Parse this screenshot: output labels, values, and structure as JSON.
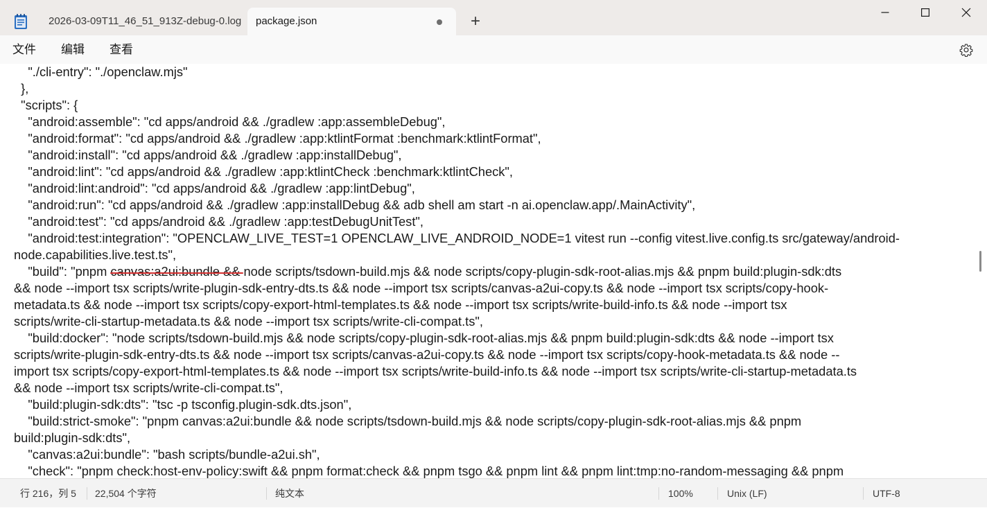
{
  "window": {
    "app_icon": "notepad-icon",
    "tabs": [
      {
        "label": "2026-03-09T11_46_51_913Z-debug-0.log",
        "active": false
      },
      {
        "label": "package.json",
        "active": true,
        "modified_indicator": "unsaved-dot-icon"
      }
    ],
    "new_tab_label": "+",
    "controls": [
      "minimize-icon",
      "maximize-icon",
      "close-icon"
    ]
  },
  "menu": {
    "items": [
      "文件",
      "编辑",
      "查看"
    ],
    "settings_icon": "gear-icon"
  },
  "editor": {
    "lines": [
      "    \"./cli-entry\": \"./openclaw.mjs\"",
      "  },",
      "  \"scripts\": {",
      "    \"android:assemble\": \"cd apps/android && ./gradlew :app:assembleDebug\",",
      "    \"android:format\": \"cd apps/android && ./gradlew :app:ktlintFormat :benchmark:ktlintFormat\",",
      "    \"android:install\": \"cd apps/android && ./gradlew :app:installDebug\",",
      "    \"android:lint\": \"cd apps/android && ./gradlew :app:ktlintCheck :benchmark:ktlintCheck\",",
      "    \"android:lint:android\": \"cd apps/android && ./gradlew :app:lintDebug\",",
      "    \"android:run\": \"cd apps/android && ./gradlew :app:installDebug && adb shell am start -n ai.openclaw.app/.MainActivity\",",
      "    \"android:test\": \"cd apps/android && ./gradlew :app:testDebugUnitTest\",",
      "    \"android:test:integration\": \"OPENCLAW_LIVE_TEST=1 OPENCLAW_LIVE_ANDROID_NODE=1 vitest run --config vitest.live.config.ts src/gateway/android-",
      "node.capabilities.live.test.ts\","
    ],
    "build_line": {
      "before": "    \"build\": \"pnpm ",
      "struck": "canvas:a2ui:bundle && ",
      "after": "node scripts/tsdown-build.mjs && node scripts/copy-plugin-sdk-root-alias.mjs && pnpm build:plugin-sdk:dts"
    },
    "lines_after": [
      "&& node --import tsx scripts/write-plugin-sdk-entry-dts.ts && node --import tsx scripts/canvas-a2ui-copy.ts && node --import tsx scripts/copy-hook-",
      "metadata.ts && node --import tsx scripts/copy-export-html-templates.ts && node --import tsx scripts/write-build-info.ts && node --import tsx",
      "scripts/write-cli-startup-metadata.ts && node --import tsx scripts/write-cli-compat.ts\",",
      "    \"build:docker\": \"node scripts/tsdown-build.mjs && node scripts/copy-plugin-sdk-root-alias.mjs && pnpm build:plugin-sdk:dts && node --import tsx",
      "scripts/write-plugin-sdk-entry-dts.ts && node --import tsx scripts/canvas-a2ui-copy.ts && node --import tsx scripts/copy-hook-metadata.ts && node --",
      "import tsx scripts/copy-export-html-templates.ts && node --import tsx scripts/write-build-info.ts && node --import tsx scripts/write-cli-startup-metadata.ts",
      "&& node --import tsx scripts/write-cli-compat.ts\",",
      "    \"build:plugin-sdk:dts\": \"tsc -p tsconfig.plugin-sdk.dts.json\",",
      "    \"build:strict-smoke\": \"pnpm canvas:a2ui:bundle && node scripts/tsdown-build.mjs && node scripts/copy-plugin-sdk-root-alias.mjs && pnpm",
      "build:plugin-sdk:dts\",",
      "    \"canvas:a2ui:bundle\": \"bash scripts/bundle-a2ui.sh\",",
      "    \"check\": \"pnpm check:host-env-policy:swift && pnpm format:check && pnpm tsgo && pnpm lint && pnpm lint:tmp:no-random-messaging && pnpm"
    ]
  },
  "status": {
    "position": "行 216，列 5",
    "char_count": "22,504 个字符",
    "format": "纯文本",
    "zoom": "100%",
    "line_ending": "Unix (LF)",
    "encoding": "UTF-8"
  }
}
